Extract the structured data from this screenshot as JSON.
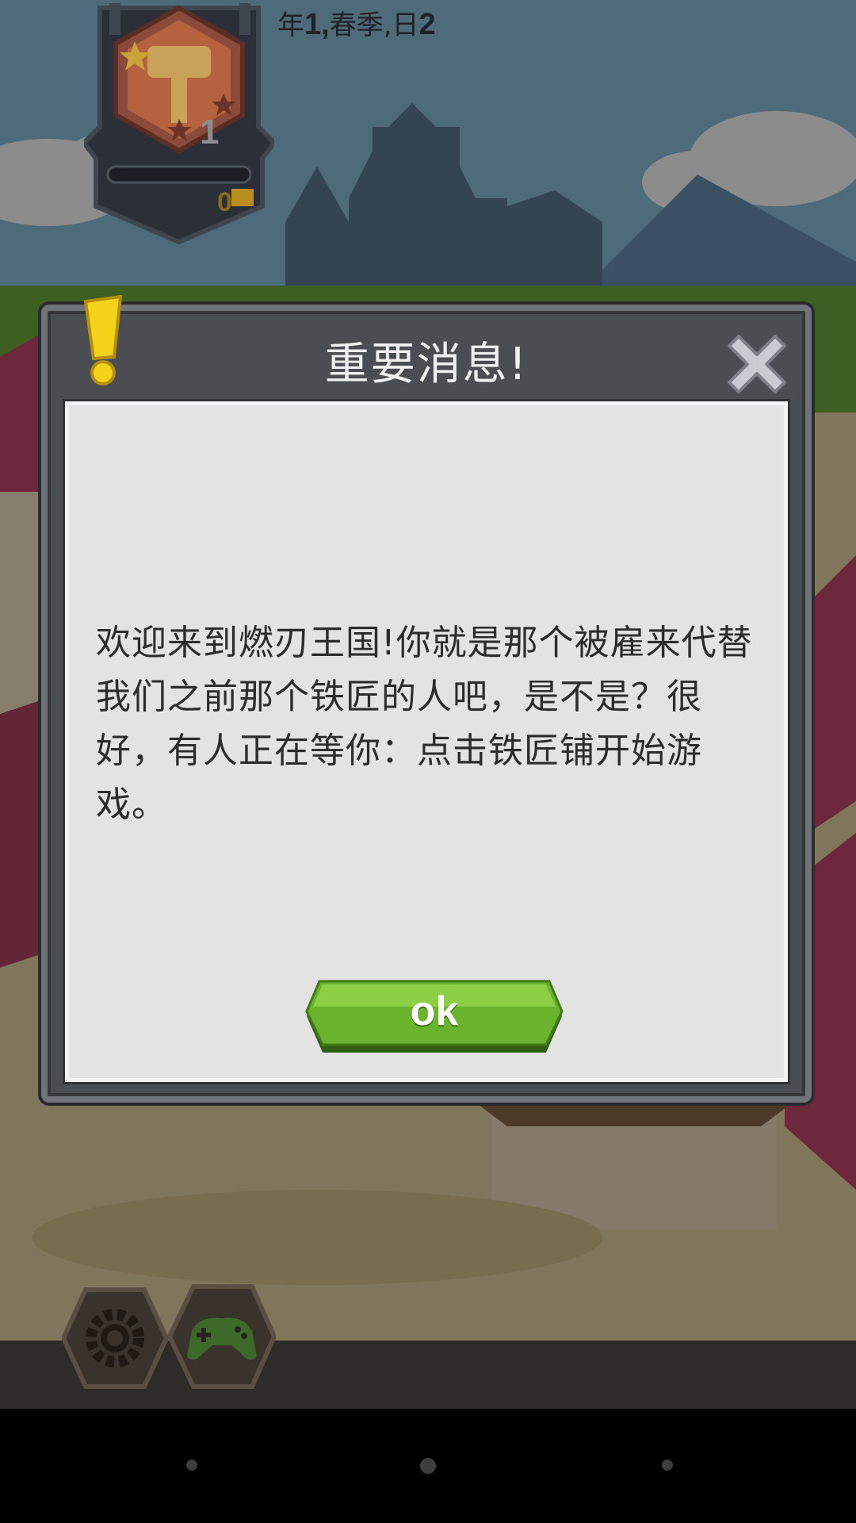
{
  "hud": {
    "level": "1",
    "currency": "0",
    "date": {
      "year_label": "年",
      "year_value": "1,",
      "season": "春季,",
      "day_label": "日",
      "day_value": "2"
    }
  },
  "dialog": {
    "title": "重要消息!",
    "message": "欢迎来到燃刃王国!你就是那个被雇来代替我们之前那个铁匠的人吧，是不是？很好，有人正在等你：点击铁匠铺开始游戏。",
    "ok_label": "ok"
  },
  "icons": {
    "level_badge": "hammer-badge-icon",
    "currency": "gold-bar-icon",
    "alert": "exclamation-icon",
    "close": "close-x-icon",
    "settings": "gear-icon",
    "games": "gamepad-icon"
  },
  "colors": {
    "ok_button": "#6ab32c",
    "dialog_frame": "#4a4d52",
    "dialog_body": "#e3e3e3",
    "alert_icon": "#f3d21a"
  }
}
